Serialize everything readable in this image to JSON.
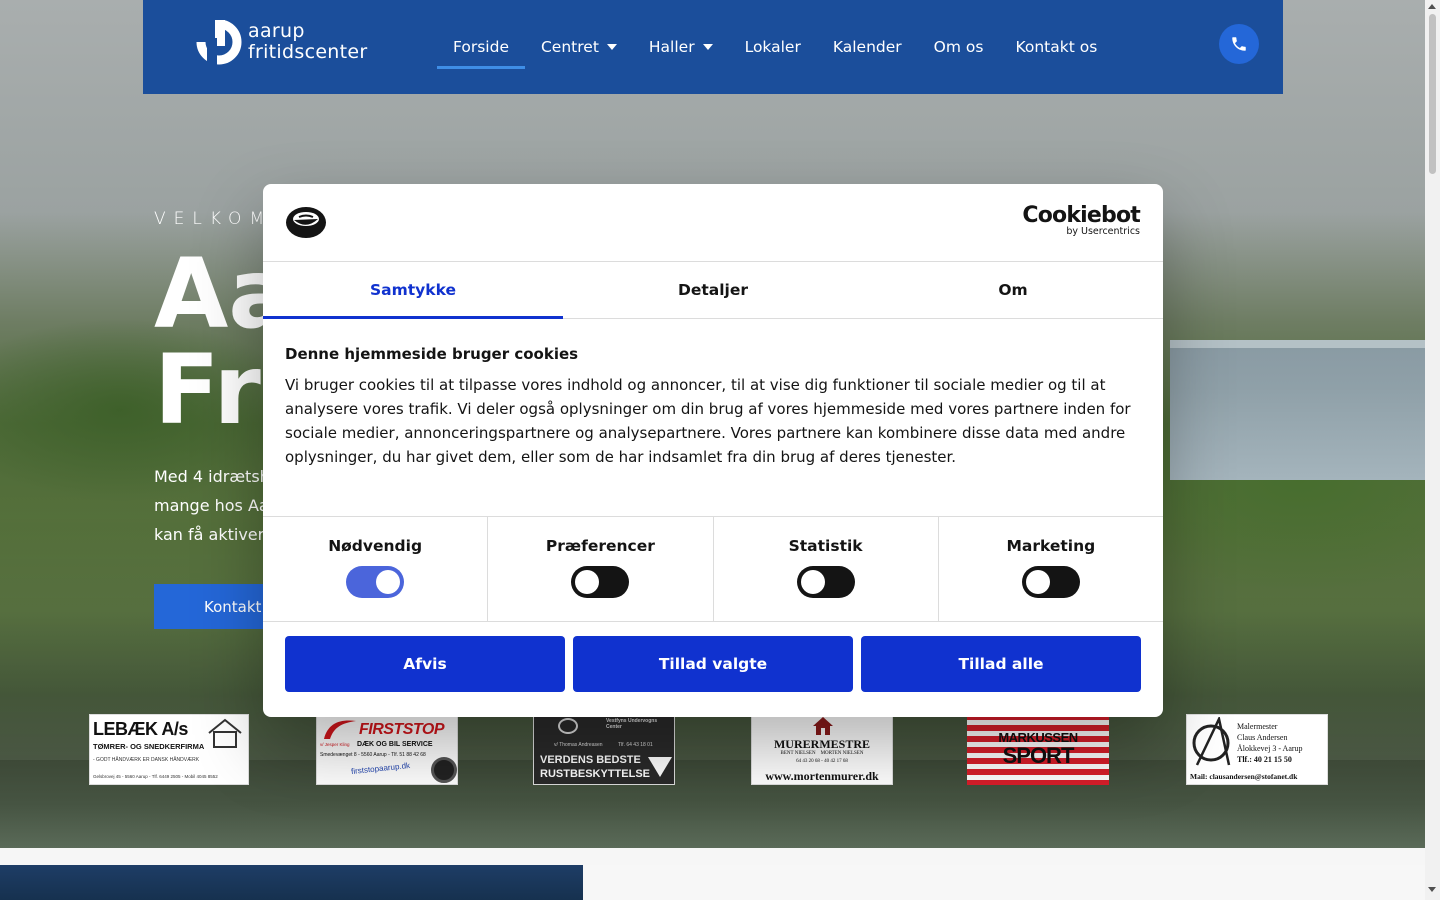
{
  "header": {
    "logo_line1": "aarup",
    "logo_line2": "fritidscenter",
    "nav": [
      {
        "label": "Forside"
      },
      {
        "label": "Centret"
      },
      {
        "label": "Haller"
      },
      {
        "label": "Lokaler"
      },
      {
        "label": "Kalender"
      },
      {
        "label": "Om os"
      },
      {
        "label": "Kontakt os"
      }
    ],
    "active_nav": "Forside"
  },
  "hero": {
    "welcome": "VELKOM",
    "title": "Aa\nFr",
    "text": "Med 4 idrætsh\nmange hos Aa\nkan få aktiver",
    "contact_button": "Kontakt"
  },
  "sponsors": {
    "lebaek": {
      "name": "LEBÆK A/s",
      "line1": "TØMRER- OG SNEDKERFIRMA",
      "line2": "- GODT HÅNDVÆRK ER DANSK HÅNDVÆRK",
      "address": "Gelsbrovej 45 - 5560 Aarup - Tlf. 6449 2505 - Mobil 4045 8552"
    },
    "firststop": {
      "name": "FIRSTSTOP",
      "line1": "DÆK OG BIL SERVICE",
      "address": "Smedevænget 8 - 5560 Aarup - Tlf. 51 88 42 68",
      "url": "firststopaarup.dk",
      "by": "v/ Jesper Kling"
    },
    "vestfyns": {
      "name": "Vestfyns Undervogns Center",
      "by": "v/ Thomas Andreasen",
      "phone": "Tlf. 64 43 18 01",
      "line1": "VERDENS BEDSTE",
      "line2": "RUSTBESKYTTELSE"
    },
    "murermestre": {
      "title": "MURERMESTRE",
      "names": "BENT NIELSEN    MORTEN NIELSEN",
      "phones": "64 43 20 68 - 40 42 17 68",
      "url": "www.mortenmurer.dk"
    },
    "markussen": {
      "line1": "MARKUSSEN",
      "line2": "SPORT"
    },
    "claus": {
      "line1": "Malermester",
      "line2": "Claus Andersen",
      "line3": "Ålokkevej 3 - Aarup",
      "line4": "Tlf.: 40 21 15 50",
      "mail": "Mail: clausandersen@stofanet.dk"
    }
  },
  "cookie": {
    "brand": "Cookiebot",
    "brand_sub": "by Usercentrics",
    "tabs": [
      "Samtykke",
      "Detaljer",
      "Om"
    ],
    "active_tab": "Samtykke",
    "heading": "Denne hjemmeside bruger cookies",
    "body": "Vi bruger cookies til at tilpasse vores indhold og annoncer, til at vise dig funktioner til sociale medier og til at analysere vores trafik. Vi deler også oplysninger om din brug af vores hjemmeside med vores partnere inden for sociale medier, annonceringspartnere og analysepartnere. Vores partnere kan kombinere disse data med andre oplysninger, du har givet dem, eller som de har indsamlet fra din brug af deres tjenester.",
    "toggles": [
      {
        "label": "Nødvendig",
        "on": true
      },
      {
        "label": "Præferencer",
        "on": false
      },
      {
        "label": "Statistik",
        "on": false
      },
      {
        "label": "Marketing",
        "on": false
      }
    ],
    "buttons": {
      "reject": "Afvis",
      "allow_selected": "Tillad valgte",
      "allow_all": "Tillad alle"
    }
  },
  "colors": {
    "header": "#1b4e9b",
    "cookie_accent": "#1032cf",
    "button": "#2467d8"
  }
}
